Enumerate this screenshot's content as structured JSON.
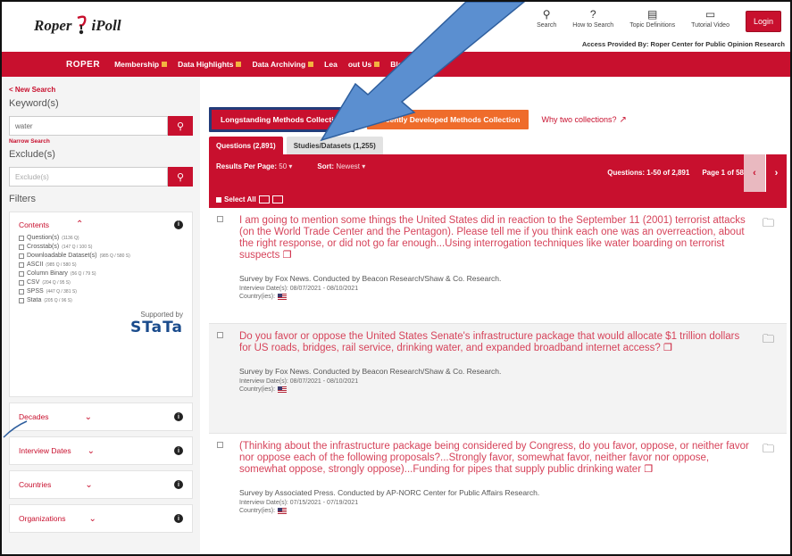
{
  "header": {
    "logo_left": "Roper",
    "logo_right": "iPoll",
    "tools": [
      {
        "icon": "search-icon",
        "glyph": "⚲",
        "label": "Search"
      },
      {
        "icon": "help-icon",
        "glyph": "?",
        "label": "How to Search"
      },
      {
        "icon": "document-icon",
        "glyph": "▤",
        "label": "Topic Definitions"
      },
      {
        "icon": "video-icon",
        "glyph": "▭",
        "label": "Tutorial Video"
      }
    ],
    "login_label": "Login",
    "access_text": "Access Provided By: Roper Center for Public Opinion Research"
  },
  "nav": {
    "brand": "ROPER",
    "items": [
      "Membership",
      "Data Highlights",
      "Data Archiving",
      "Lea",
      "out Us",
      "Blog"
    ]
  },
  "sidebar": {
    "new_search": "< New Search",
    "keyword_label": "Keyword(s)",
    "keyword_value": "water",
    "narrow_search": "Narrow Search",
    "exclude_label": "Exclude(s)",
    "exclude_placeholder": "Exclude(s)",
    "filters_label": "Filters",
    "contents": {
      "title": "Contents",
      "options": [
        {
          "label": "Question(s)",
          "count": "(1136 Q)"
        },
        {
          "label": "Crosstab(s)",
          "count": "(147 Q / 100 S)"
        },
        {
          "label": "Downloadable Dataset(s)",
          "count": "(985 Q / 580 S)"
        },
        {
          "label": "ASCII",
          "count": "(985 Q / 580 S)"
        },
        {
          "label": "Column Binary",
          "count": "(56 Q / 79 S)"
        },
        {
          "label": "CSV",
          "count": "(204 Q / 95 S)"
        },
        {
          "label": "SPSS",
          "count": "(447 Q / 381 S)"
        },
        {
          "label": "Stata",
          "count": "(205 Q / 96 S)"
        }
      ],
      "supported_by": "Supported by",
      "stata_logo": "STaTa"
    },
    "collapsed_filters": [
      "Decades",
      "Interview Dates",
      "Countries",
      "Organizations"
    ]
  },
  "main": {
    "collection_a": "Longstanding Methods Collection",
    "collection_b": "Recently Developed Methods Collection",
    "why_link": "Why two collections?",
    "tabs": [
      "Questions (2,891)",
      "Studies/Datasets (1,255)"
    ],
    "results_per_page_label": "Results Per Page:",
    "results_per_page_value": "50 ▾",
    "sort_label": "Sort:",
    "sort_value": "Newest ▾",
    "questions_range": "Questions: 1-50 of 2,891",
    "page_info": "Page 1 of 58",
    "prev": "‹",
    "next": "›",
    "select_all": "Select All"
  },
  "results": [
    {
      "question": "I am going to mention some things the United States did in reaction to the September 11 (2001) terrorist attacks (on the World Trade Center and the Pentagon). Please tell me if you think each one was an overreaction, about the right response, or did not go far enough...Using interrogation techniques like water boarding on terrorist suspects",
      "survey": "Survey by Fox News. Conducted by Beacon Research/Shaw & Co. Research.",
      "dates": "Interview Date(s): 08/07/2021 - 08/10/2021",
      "country_label": "Country(ies):"
    },
    {
      "question": "Do you favor or oppose the United States Senate's infrastructure package that would allocate $1 trillion dollars for US roads, bridges, rail service, drinking water, and expanded broadband internet access?",
      "survey": "Survey by Fox News. Conducted by Beacon Research/Shaw & Co. Research.",
      "dates": "Interview Date(s): 08/07/2021 - 08/10/2021",
      "country_label": "Country(ies):"
    },
    {
      "question": "(Thinking about the infrastructure package being considered by Congress, do you favor, oppose, or neither favor nor oppose each of the following proposals?...Strongly favor, somewhat favor, neither favor nor oppose, somewhat oppose, strongly oppose)...Funding for pipes that supply public drinking water",
      "survey": "Survey by Associated Press. Conducted by AP-NORC Center for Public Affairs Research.",
      "dates": "Interview Date(s): 07/15/2021 - 07/19/2021",
      "country_label": "Country(ies):"
    }
  ],
  "colors": {
    "brand_red": "#c8102e",
    "accent_orange": "#ef6c2b",
    "annotation_arrow": "#5b8fd0"
  }
}
